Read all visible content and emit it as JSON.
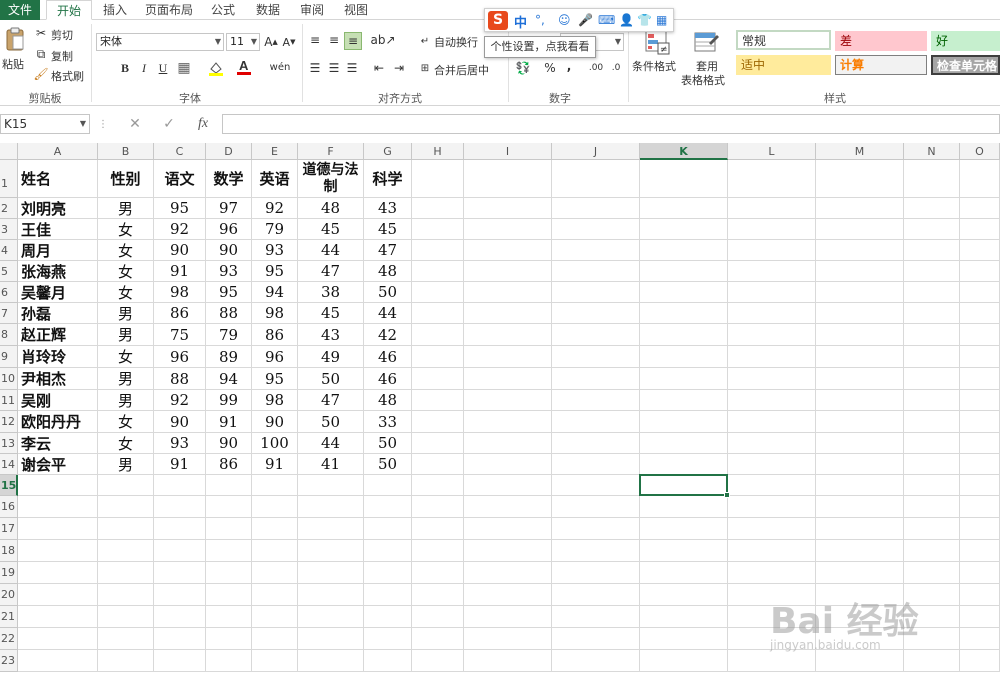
{
  "tabs": [
    "文件",
    "开始",
    "插入",
    "页面布局",
    "公式",
    "数据",
    "审阅",
    "视图"
  ],
  "ribbon": {
    "clipboard": {
      "paste": "粘贴",
      "cut": "剪切",
      "copy": "复制",
      "format_painter": "格式刷",
      "label": "剪贴板"
    },
    "font": {
      "name": "宋体",
      "size": "11",
      "grow": "A",
      "shrink": "A",
      "bold": "B",
      "italic": "I",
      "underline": "U",
      "phonetic": "wén",
      "label": "字体"
    },
    "align": {
      "wrap": "自动换行",
      "merge": "合并后居中",
      "label": "对齐方式"
    },
    "number": {
      "percent": "%",
      "comma": ",",
      "label": "数字"
    },
    "styles": {
      "conditional": "条件格式",
      "table_fmt_1": "套用",
      "table_fmt_2": "表格格式",
      "normal": "常规",
      "bad": "差",
      "good": "好",
      "neutral": "适中",
      "calculation": "计算",
      "check_cell": "检查单元格",
      "label": "样式"
    }
  },
  "ime": {
    "logo": "S",
    "mode": "中",
    "tooltip": "个性设置，点我看看"
  },
  "formula_bar": {
    "name_box": "K15",
    "cancel": "✕",
    "enter": "✓",
    "fx": "fx",
    "value": ""
  },
  "columns": [
    "A",
    "B",
    "C",
    "D",
    "E",
    "F",
    "G",
    "H",
    "I",
    "J",
    "K",
    "L",
    "M",
    "N",
    "O"
  ],
  "rows": [
    "1",
    "2",
    "3",
    "4",
    "5",
    "6",
    "7",
    "8",
    "9",
    "10",
    "11",
    "12",
    "13",
    "14",
    "15",
    "16",
    "17",
    "18",
    "19",
    "20",
    "21",
    "22",
    "23"
  ],
  "selected": {
    "column": "K",
    "row": "15"
  },
  "sheet": {
    "headers": [
      "姓名",
      "性别",
      "语文",
      "数学",
      "英语",
      "道德与法制",
      "科学"
    ],
    "rows": [
      [
        "刘明亮",
        "男",
        "95",
        "97",
        "92",
        "48",
        "43"
      ],
      [
        "王佳",
        "女",
        "92",
        "96",
        "79",
        "45",
        "45"
      ],
      [
        "周月",
        "女",
        "90",
        "90",
        "93",
        "44",
        "47"
      ],
      [
        "张海燕",
        "女",
        "91",
        "93",
        "95",
        "47",
        "48"
      ],
      [
        "吴馨月",
        "女",
        "98",
        "95",
        "94",
        "38",
        "50"
      ],
      [
        "孙磊",
        "男",
        "86",
        "88",
        "98",
        "45",
        "44"
      ],
      [
        "赵正辉",
        "男",
        "75",
        "79",
        "86",
        "43",
        "42"
      ],
      [
        "肖玲玲",
        "女",
        "96",
        "89",
        "96",
        "49",
        "46"
      ],
      [
        "尹相杰",
        "男",
        "88",
        "94",
        "95",
        "50",
        "46"
      ],
      [
        "吴刚",
        "男",
        "92",
        "99",
        "98",
        "47",
        "48"
      ],
      [
        "欧阳丹丹",
        "女",
        "90",
        "91",
        "90",
        "50",
        "33"
      ],
      [
        "李云",
        "女",
        "93",
        "90",
        "100",
        "44",
        "50"
      ],
      [
        "谢会平",
        "男",
        "91",
        "86",
        "91",
        "41",
        "50"
      ]
    ]
  },
  "watermark": {
    "main": "Bai 经验",
    "sub": "jingyan.baidu.com"
  },
  "colors": {
    "accent": "#217346",
    "bad_bg": "#ffc7ce",
    "good_bg": "#c6efce",
    "neutral_bg": "#ffeb9c",
    "calc_bg": "#f2f2f2",
    "check_bg": "#a5a5a5"
  }
}
